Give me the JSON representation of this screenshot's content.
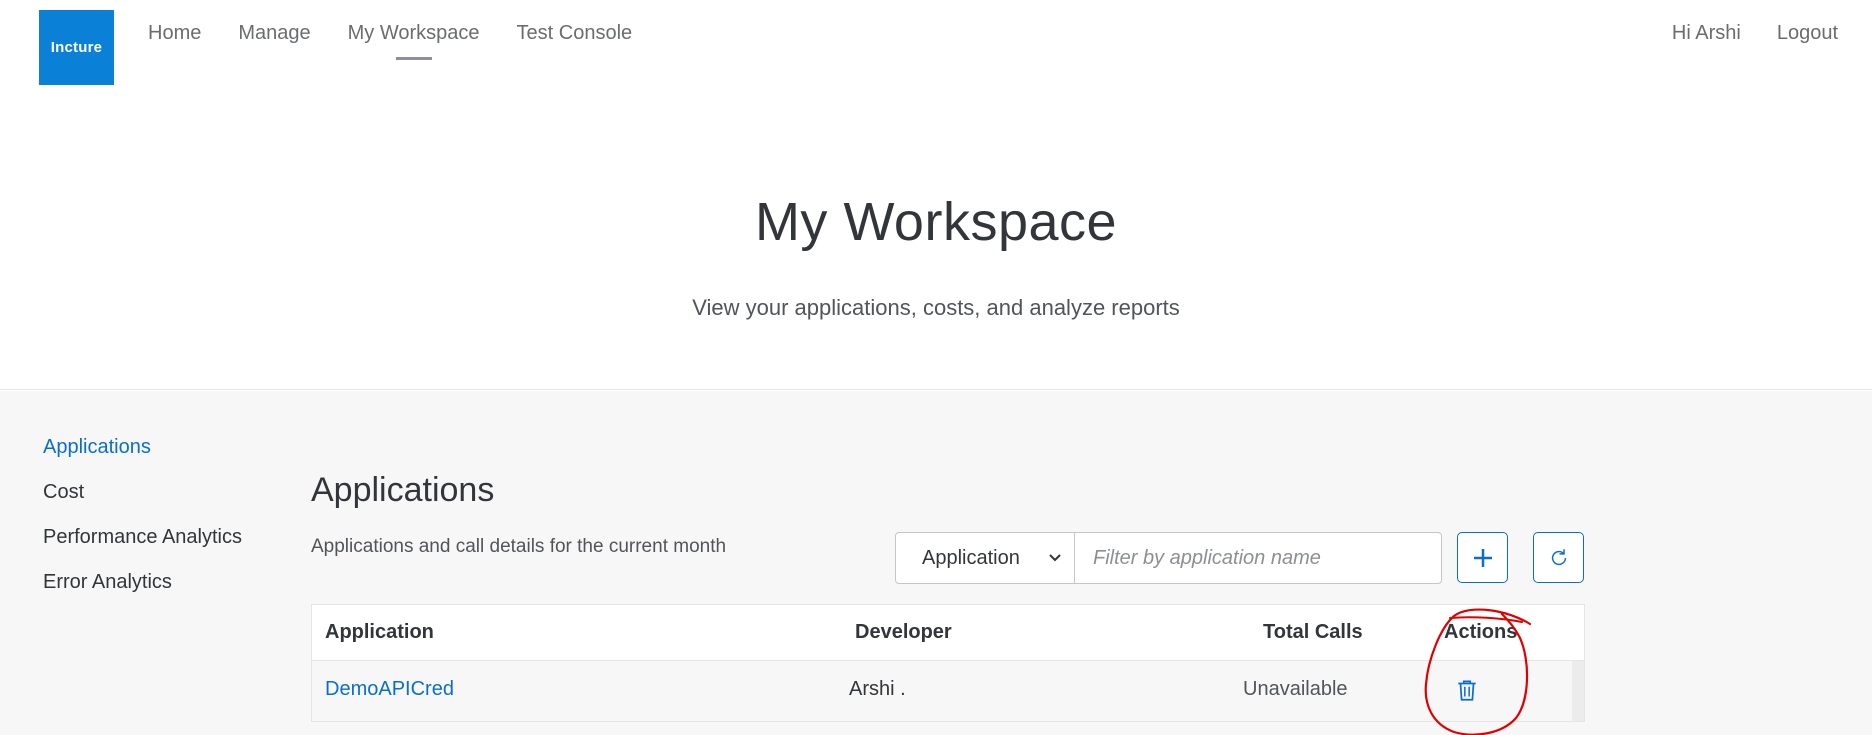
{
  "header": {
    "logo_text": "Incture",
    "nav": [
      {
        "label": "Home",
        "active": false
      },
      {
        "label": "Manage",
        "active": false
      },
      {
        "label": "My Workspace",
        "active": true
      },
      {
        "label": "Test Console",
        "active": false
      }
    ],
    "greeting": "Hi Arshi",
    "logout": "Logout"
  },
  "hero": {
    "title": "My Workspace",
    "subtitle": "View your applications, costs, and analyze reports"
  },
  "sidebar": {
    "items": [
      {
        "label": "Applications",
        "active": true
      },
      {
        "label": "Cost",
        "active": false
      },
      {
        "label": "Performance Analytics",
        "active": false
      },
      {
        "label": "Error Analytics",
        "active": false
      }
    ]
  },
  "main": {
    "title": "Applications",
    "subtitle": "Applications and call details for the current month",
    "filter": {
      "selected": "Application",
      "placeholder": "Filter by application name",
      "value": ""
    },
    "table": {
      "columns": [
        "Application",
        "Developer",
        "Total Calls",
        "Actions"
      ],
      "rows": [
        {
          "application": "DemoAPICred",
          "developer": "Arshi .",
          "total_calls": "Unavailable"
        }
      ]
    }
  },
  "colors": {
    "brand": "#0a80d6",
    "accent": "#0a6ed1",
    "annotation": "#e00000"
  },
  "icons": {
    "add": "plus-icon",
    "refresh": "refresh-icon",
    "delete": "trash-icon",
    "select": "chevron-down-icon"
  }
}
